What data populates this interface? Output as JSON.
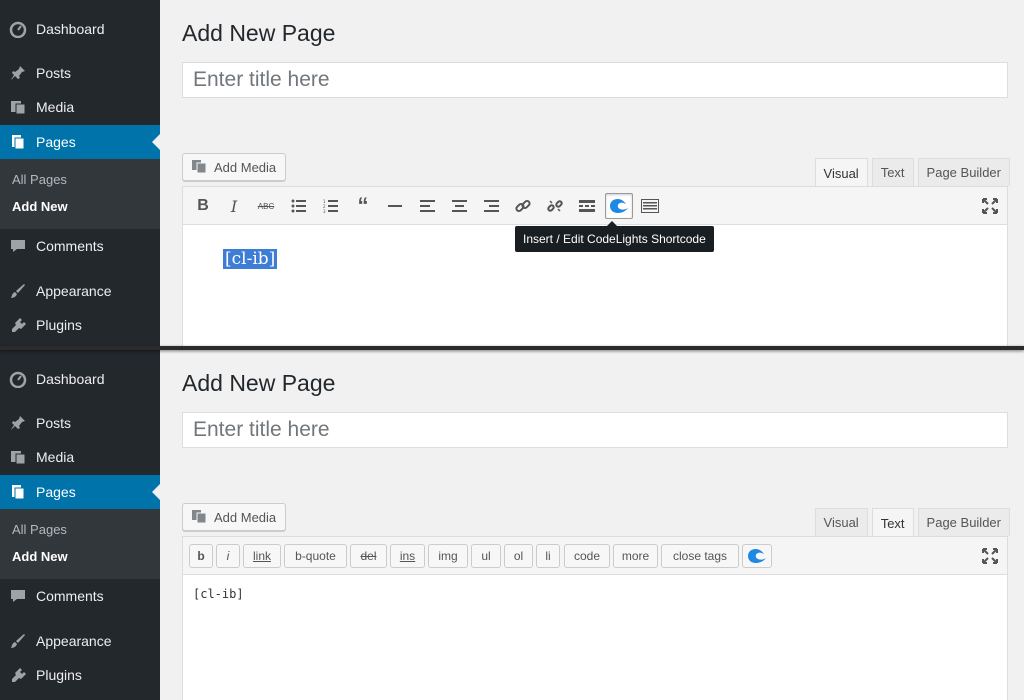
{
  "menu": {
    "dashboard": "Dashboard",
    "posts": "Posts",
    "media": "Media",
    "pages": "Pages",
    "all_pages": "All Pages",
    "add_new": "Add New",
    "comments": "Comments",
    "appearance": "Appearance",
    "plugins": "Plugins"
  },
  "page_title": "Add New Page",
  "title_placeholder": "Enter title here",
  "add_media": "Add Media",
  "tabs": {
    "visual": "Visual",
    "text": "Text",
    "page_builder": "Page Builder"
  },
  "top_editor": {
    "active_tab": "Visual",
    "content": "[cl-ib]",
    "tooltip": "Insert / Edit CodeLights Shortcode",
    "toolbar_icons": [
      "bold-icon",
      "italic-icon",
      "strikethrough-icon",
      "bullet-list-icon",
      "numbered-list-icon",
      "blockquote-icon",
      "horizontal-line-icon",
      "align-left-icon",
      "align-center-icon",
      "align-right-icon",
      "link-icon",
      "unlink-icon",
      "read-more-icon",
      "codelights-icon",
      "toolbar-toggle-icon",
      "fullscreen-icon"
    ]
  },
  "bottom_editor": {
    "active_tab": "Text",
    "content": "[cl-ib]",
    "quicktags": [
      "b",
      "i",
      "link",
      "b-quote",
      "del",
      "ins",
      "img",
      "ul",
      "ol",
      "li",
      "code",
      "more",
      "close tags"
    ]
  },
  "colors": {
    "sidebar": "#23282d",
    "active": "#0073aa",
    "submenu": "#32373c",
    "selection": "#3d7dd6"
  }
}
